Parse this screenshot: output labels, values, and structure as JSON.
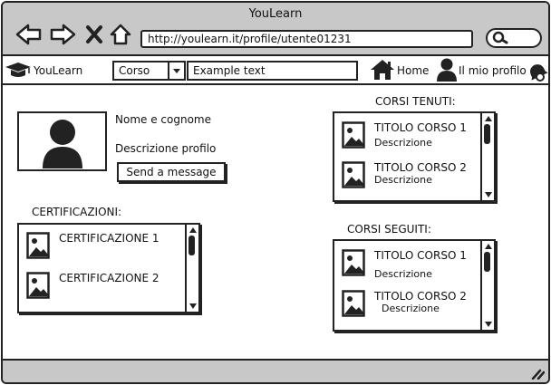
{
  "window": {
    "title": "YouLearn",
    "url": "http://youlearn.it/profile/utente01231"
  },
  "menubar": {
    "brand": "YouLearn",
    "category_select": "Corso",
    "search_text": "Example text",
    "home_label": "Home",
    "profile_label": "Il mio profilo"
  },
  "profile": {
    "name": "Nome e cognome",
    "description": "Descrizione profilo",
    "send_message": "Send a message"
  },
  "certificazioni": {
    "title": "CERTIFICAZIONI:",
    "items": [
      "CERTIFICAZIONE 1",
      "CERTIFICAZIONE 2"
    ]
  },
  "corsi_tenuti": {
    "title": "CORSI TENUTI:",
    "items": [
      {
        "title": "TITOLO CORSO 1",
        "desc": "Descrizione"
      },
      {
        "title": "TITOLO CORSO 2",
        "desc": "Descrizione"
      }
    ]
  },
  "corsi_seguiti": {
    "title": "CORSI SEGUITI:",
    "items": [
      {
        "title": "TITOLO CORSO 1",
        "desc": "Descrizione"
      },
      {
        "title": "TITOLO CORSO 2",
        "desc": "Descrizione"
      }
    ]
  }
}
